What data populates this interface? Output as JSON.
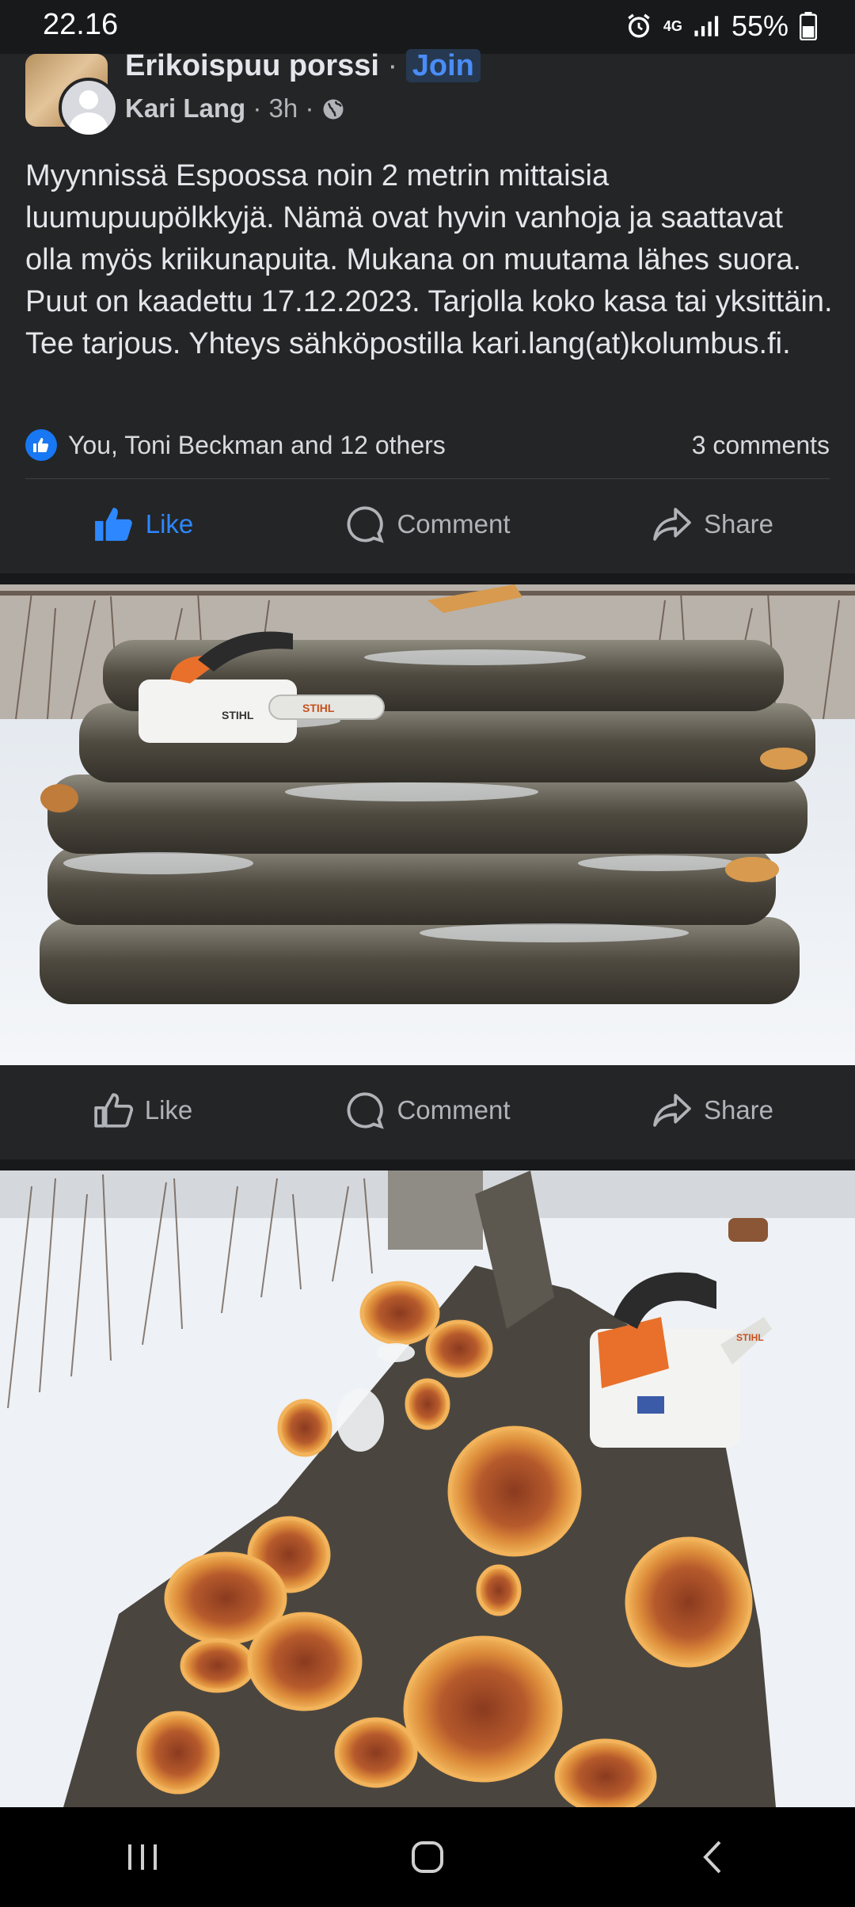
{
  "status": {
    "time": "22.16",
    "network": "4G",
    "battery": "55%"
  },
  "group": {
    "name": "Erikoispuu porssi",
    "join_label": "Join",
    "separator": "·"
  },
  "post": {
    "author": "Kari Lang",
    "time": "3h",
    "text": "Myynnissä Espoossa noin 2 metrin mittaisia luumupuupölkkyjä. Nämä ovat hyvin vanhoja ja saattavat olla myös kriikunapuita. Mukana on muutama lähes suora. Puut on kaadettu 17.12.2023. Tarjolla koko kasa tai yksittäin. Tee tarjous. Yhteys sähköpostilla kari.lang(at)kolumbus.fi.",
    "reactions_text": "You, Toni Beckman and 12 others",
    "comments_text": "3 comments"
  },
  "actions": {
    "like": "Like",
    "comment": "Comment",
    "share": "Share"
  },
  "photo1": {
    "brand": "STIHL"
  },
  "photo2": {
    "brand": "STIHL"
  }
}
